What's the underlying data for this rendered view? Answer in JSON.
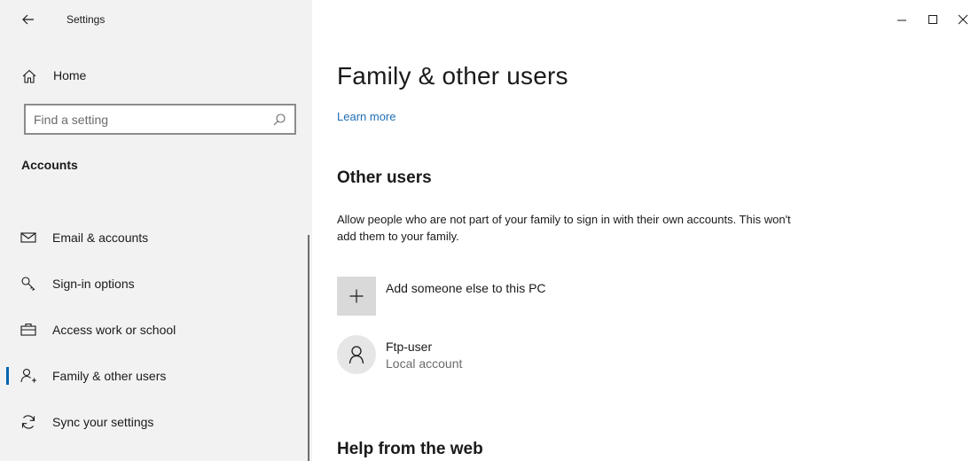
{
  "window": {
    "title": "Settings"
  },
  "sidebar": {
    "home_label": "Home",
    "search": {
      "placeholder": "Find a setting",
      "value": ""
    },
    "section_title": "Accounts",
    "items": [
      {
        "label": "Email & accounts",
        "icon": "mail-icon",
        "selected": false
      },
      {
        "label": "Sign-in options",
        "icon": "key-icon",
        "selected": false
      },
      {
        "label": "Access work or school",
        "icon": "briefcase-icon",
        "selected": false
      },
      {
        "label": "Family & other users",
        "icon": "person-add-icon",
        "selected": true
      },
      {
        "label": "Sync your settings",
        "icon": "sync-icon",
        "selected": false
      }
    ]
  },
  "main": {
    "title": "Family & other users",
    "learn_more": "Learn more",
    "other_users": {
      "heading": "Other users",
      "description": "Allow people who are not part of your family to sign in with their own accounts. This won't add them to your family.",
      "add_label": "Add someone else to this PC",
      "users": [
        {
          "name": "Ftp-user",
          "type": "Local account"
        }
      ]
    },
    "help_heading": "Help from the web"
  },
  "colors": {
    "accent": "#0063b1",
    "link": "#1f6fb4",
    "sidebar_bg": "#f2f2f2"
  }
}
